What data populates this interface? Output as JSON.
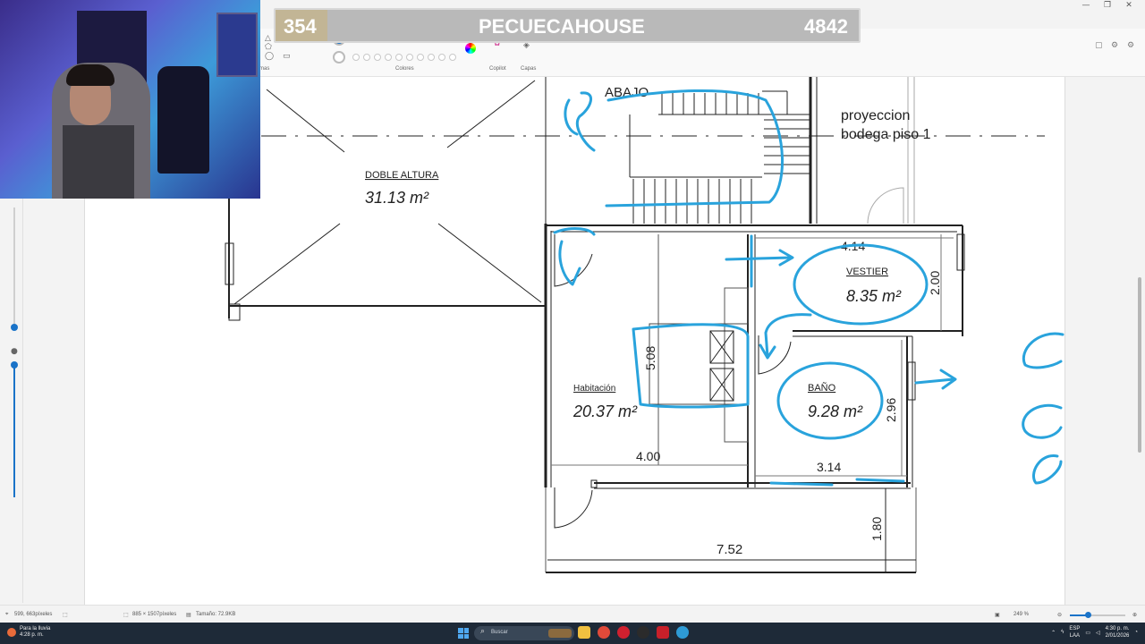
{
  "window": {
    "controls": [
      "—",
      "❐",
      "✕"
    ]
  },
  "ribbon": {
    "groups": {
      "shapes_label": "mas",
      "colors_label": "Colores",
      "copilot_label": "Copilot",
      "layers_label": "Capas"
    },
    "palette": {
      "selected_color": "#1a73c8",
      "row1": [
        "#000000",
        "#7f7f7f",
        "#880015",
        "#ed1c24",
        "#ff7f27",
        "#fff200",
        "#22b14c",
        "#00a2e8",
        "#3f48cc",
        "#a349a4"
      ],
      "row2": [
        "#ffffff",
        "#c3c3c3",
        "#b97a57",
        "#ffaec9",
        "#ffc90e",
        "#efe4b0",
        "#b5e61d",
        "#99d9ea",
        "#7092be",
        "#c8bfe7"
      ]
    }
  },
  "overlay": {
    "left_score": "354",
    "channel_name": "PECUECAHOUSE",
    "right_score": "4842"
  },
  "floor_plan": {
    "labels": {
      "abajo": "ABAJO",
      "proyeccion_line1": "proyeccion",
      "proyeccion_line2": "bodega piso 1",
      "doble_altura": "DOBLE ALTURA",
      "doble_altura_area": "31.13 m²",
      "vestier": "VESTIER",
      "vestier_area": "8.35 m²",
      "habitacion": "Habitación",
      "habitacion_area": "20.37 m²",
      "bano": "BAÑO",
      "bano_area": "9.28 m²"
    },
    "dimensions": {
      "d_4_14": "4.14",
      "d_2_00": "2.00",
      "d_5_08": "5.08",
      "d_2_96": "2.96",
      "d_4_00": "4.00",
      "d_3_14": "3.14",
      "d_1_80": "1.80",
      "d_7_52": "7.52"
    },
    "annotation_color": "#29a3dc"
  },
  "statusbar": {
    "cursor_position": "599, 663píxeles",
    "selection_size": "885 × 1507píxeles",
    "file_size": "Tamaño: 72.9KB",
    "zoom": "249 %"
  },
  "taskbar": {
    "weather_line1": "Para la lluvia",
    "weather_line2": "4:28 p. m.",
    "search_placeholder": "Buscar",
    "lang_line1": "ESP",
    "lang_line2": "LAA",
    "time": "4:30 p. m.",
    "date": "2/01/2026"
  }
}
